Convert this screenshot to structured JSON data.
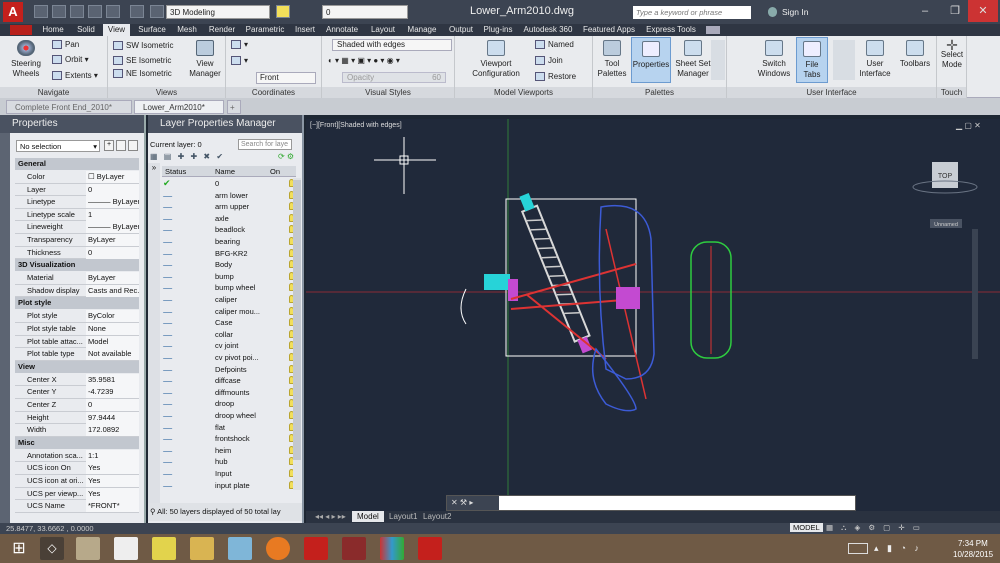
{
  "app": {
    "title": "Lower_Arm2010.dwg",
    "workspace": "3D Modeling",
    "layer_combo": "0",
    "search_placeholder": "Type a keyword or phrase",
    "sign_in": "Sign In"
  },
  "ribbon_tabs": [
    "Home",
    "Solid",
    "View",
    "Surface",
    "Mesh",
    "Render",
    "Parametric",
    "Insert",
    "Annotate",
    "Layout",
    "Manage",
    "Output",
    "Plug-ins",
    "Autodesk 360",
    "Featured Apps",
    "Express Tools"
  ],
  "ribbon": {
    "navigate": {
      "title": "Navigate",
      "steering": "Steering\nWheels",
      "pan": "Pan",
      "orbit": "Orbit",
      "extents": "Extents"
    },
    "views": {
      "title": "Views",
      "sw": "SW Isometric",
      "se": "SE Isometric",
      "ne": "NE Isometric",
      "view_manager": "View\nManager"
    },
    "coordinates": {
      "title": "Coordinates",
      "front": "Front"
    },
    "visual_styles": {
      "title": "Visual Styles",
      "style": "Shaded with edges",
      "opacity": "Opacity",
      "opacity_value": "60"
    },
    "model_viewports": {
      "title": "Model Viewports",
      "viewport_config": "Viewport\nConfiguration",
      "named": "Named",
      "join": "Join",
      "restore": "Restore"
    },
    "palettes": {
      "title": "Palettes",
      "tool": "Tool\nPalettes",
      "properties": "Properties",
      "sheet_set": "Sheet Set\nManager"
    },
    "user_interface": {
      "title": "User Interface",
      "switch": "Switch\nWindows",
      "file_tabs": "File Tabs",
      "ui": "User\nInterface",
      "toolbars": "Toolbars"
    },
    "touch": {
      "title": "Touch",
      "select": "Select\nMode"
    }
  },
  "doc_tabs": [
    "Complete Front End_2010*",
    "Lower_Arm2010*"
  ],
  "properties": {
    "title": "Properties",
    "selection": "No selection",
    "sections": [
      {
        "name": "General",
        "rows": [
          [
            "Color",
            "☐ ByLayer"
          ],
          [
            "Layer",
            "0"
          ],
          [
            "Linetype",
            "——— ByLayer"
          ],
          [
            "Linetype scale",
            "1"
          ],
          [
            "Lineweight",
            "——— ByLayer"
          ],
          [
            "Transparency",
            "ByLayer"
          ],
          [
            "Thickness",
            "0"
          ]
        ]
      },
      {
        "name": "3D Visualization",
        "rows": [
          [
            "Material",
            "ByLayer"
          ],
          [
            "Shadow display",
            "Casts and Rec..."
          ]
        ]
      },
      {
        "name": "Plot style",
        "rows": [
          [
            "Plot style",
            "ByColor"
          ],
          [
            "Plot style table",
            "None"
          ],
          [
            "Plot table attac...",
            "Model"
          ],
          [
            "Plot table type",
            "Not available"
          ]
        ]
      },
      {
        "name": "View",
        "rows": [
          [
            "Center X",
            "35.9581"
          ],
          [
            "Center Y",
            "-4.7239"
          ],
          [
            "Center Z",
            "0"
          ],
          [
            "Height",
            "97.9444"
          ],
          [
            "Width",
            "172.0892"
          ]
        ]
      },
      {
        "name": "Misc",
        "rows": [
          [
            "Annotation sca...",
            "1:1"
          ],
          [
            "UCS icon On",
            "Yes"
          ],
          [
            "UCS icon at ori...",
            "Yes"
          ],
          [
            "UCS per viewp...",
            "Yes"
          ],
          [
            "UCS Name",
            "*FRONT*"
          ]
        ]
      }
    ]
  },
  "layers": {
    "title": "Layer Properties Manager",
    "current": "Current layer: 0",
    "search": "Search for laye",
    "cols": {
      "status": "Status",
      "name": "Name",
      "on": "On"
    },
    "names": [
      "0",
      "arm lower",
      "arm upper",
      "axle",
      "beadlock",
      "bearing",
      "BFG-KR2",
      "Body",
      "bump",
      "bump wheel",
      "caliper",
      "caliper mou...",
      "Case",
      "collar",
      "cv joint",
      "cv pivot poi...",
      "Defpoints",
      "diffcase",
      "diffmounts",
      "droop",
      "droop wheel",
      "flat",
      "frontshock",
      "heim",
      "hub",
      "Input",
      "input plate"
    ],
    "footer": "All: 50 layers displayed of 50 total lay"
  },
  "viewport": {
    "label": "[−][Front][Shaded with edges]",
    "cube": "TOP",
    "unnamed": "Unnamed"
  },
  "layout_tabs": [
    "Model",
    "Layout1",
    "Layout2"
  ],
  "status": {
    "coords": "25.8477, 33.6662 , 0.0000",
    "model": "MODEL"
  },
  "taskbar": {
    "time": "7:34 PM",
    "date": "10/28/2015"
  }
}
